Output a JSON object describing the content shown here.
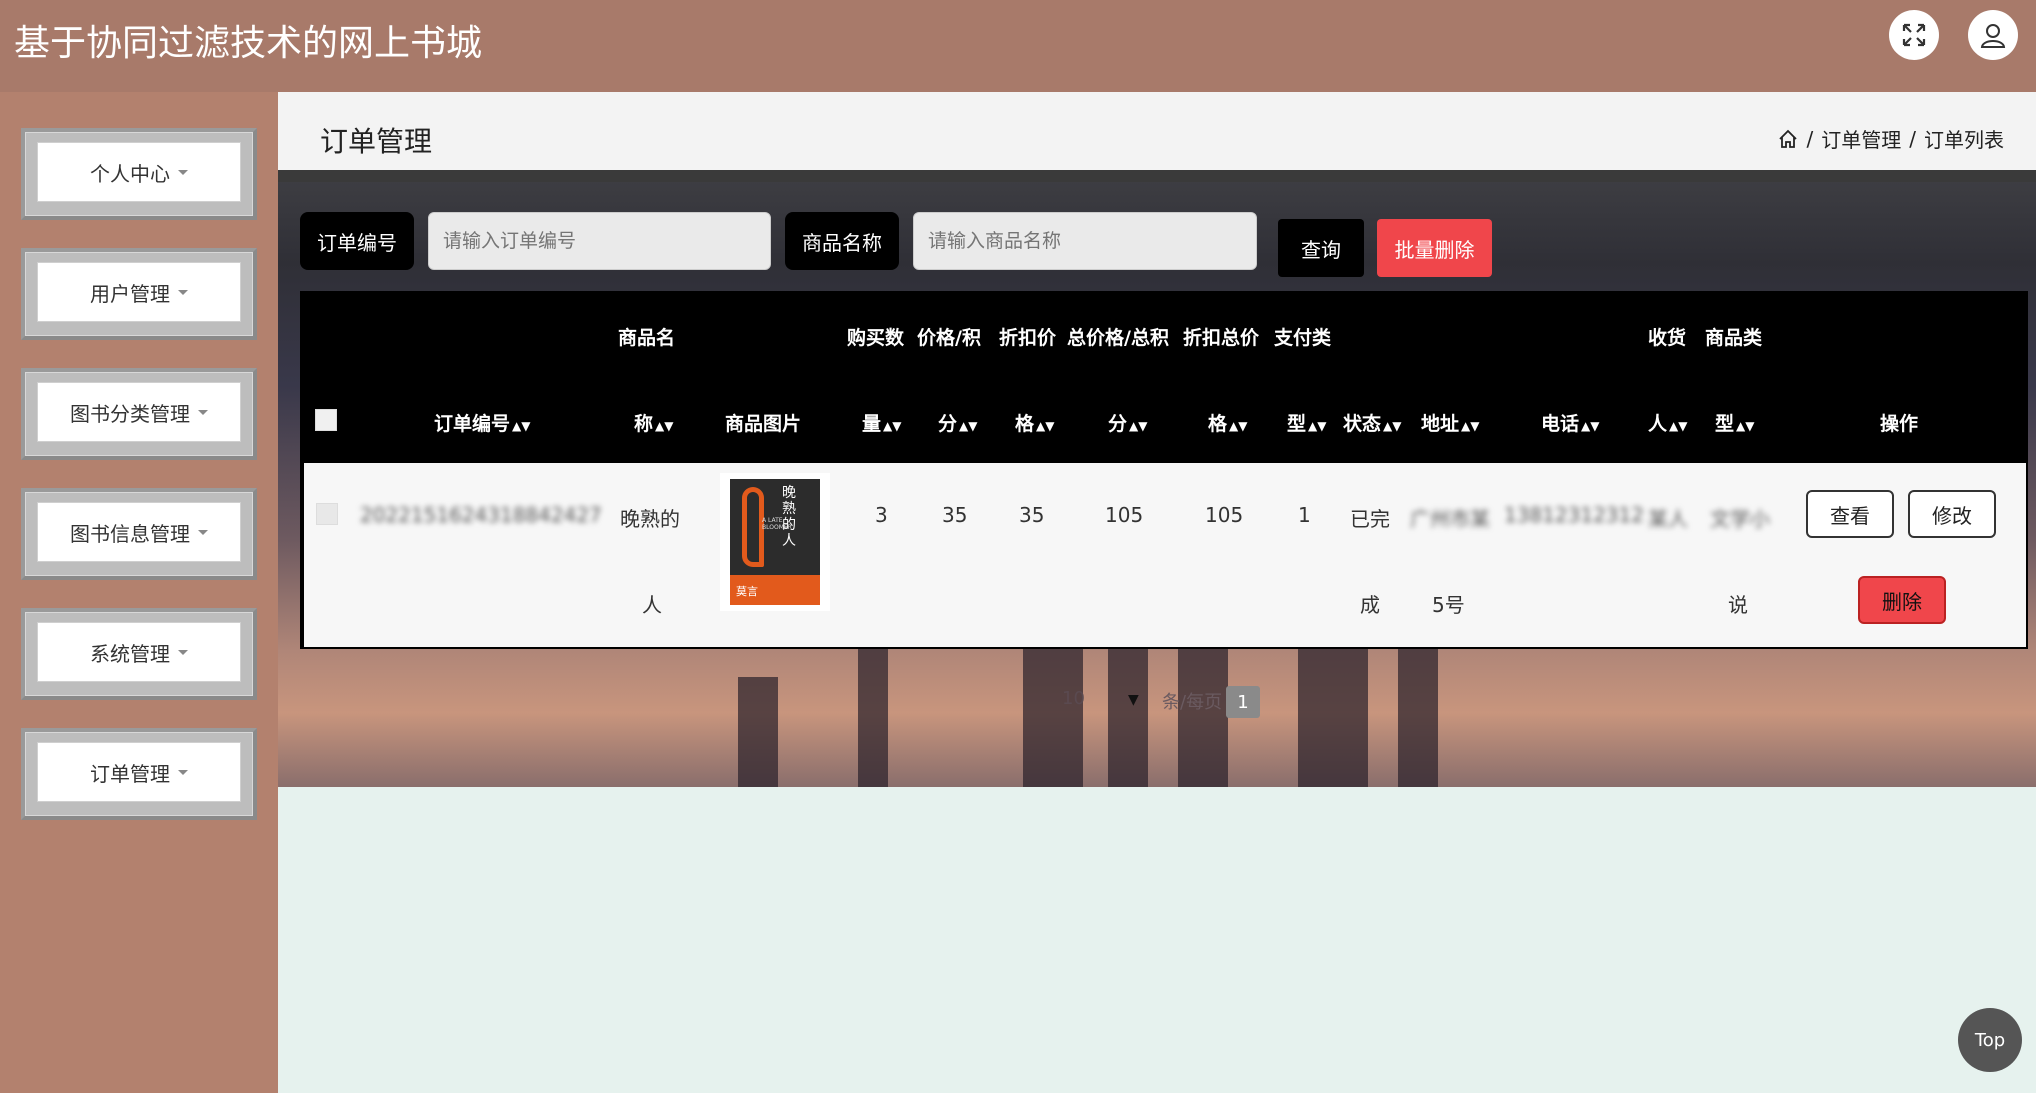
{
  "app": {
    "title": "基于协同过滤技术的网上书城"
  },
  "header": {
    "fullscreen_icon": "fullscreen-icon",
    "user_icon": "user-icon"
  },
  "sidebar": {
    "items": [
      {
        "label": "个人中心"
      },
      {
        "label": "用户管理"
      },
      {
        "label": "图书分类管理"
      },
      {
        "label": "图书信息管理"
      },
      {
        "label": "系统管理"
      },
      {
        "label": "订单管理"
      }
    ]
  },
  "page": {
    "title": "订单管理"
  },
  "breadcrumb": {
    "home_icon": "home-icon",
    "sep": "/",
    "level1": "订单管理",
    "level2": "订单列表"
  },
  "search": {
    "order_no_label": "订单编号",
    "order_no_placeholder": "请输入订单编号",
    "product_name_label": "商品名称",
    "product_name_placeholder": "请输入商品名称",
    "query_button": "查询",
    "batch_delete_button": "批量删除"
  },
  "table": {
    "headers": {
      "order_no": "订单编号",
      "product_name_a": "商品名",
      "product_name_b": "称",
      "product_image": "商品图片",
      "qty_a": "购买数",
      "qty_b": "量",
      "price_a": "价格/积",
      "price_b": "分",
      "discount_a": "折扣价",
      "discount_b": "格",
      "total_a": "总价格/总积",
      "total_b": "分",
      "discount_total_a": "折扣总价",
      "discount_total_b": "格",
      "pay_type_a": "支付类",
      "pay_type_b": "型",
      "status": "状态",
      "address": "地址",
      "phone": "电话",
      "receiver_a": "收货",
      "receiver_b": "人",
      "category_a": "商品类",
      "category_b": "型",
      "actions": "操作"
    },
    "rows": [
      {
        "order_no": "2022151624318842427",
        "product_name_a": "晚熟的",
        "product_name_b": "人",
        "qty": "3",
        "price": "35",
        "discount": "35",
        "total": "105",
        "discount_total": "105",
        "pay_type": "1",
        "status_a": "已完",
        "status_b": "成",
        "address_a": "广州市某",
        "address_b": "5号",
        "phone": "13812312312",
        "receiver": "某人",
        "category_a": "文学小",
        "category_b": "说",
        "view_button": "查看",
        "edit_button": "修改",
        "delete_button": "删除"
      }
    ]
  },
  "book_cover": {
    "title_cn": "晚熟的人",
    "title_en": "A LATE BLOOMER",
    "author": "莫言",
    "bg": "#2c2c2c",
    "accent": "#e25a1c"
  },
  "pagination": {
    "page_size": "10",
    "per_page_label": "条/每页",
    "current_page": "1"
  },
  "back_to_top": {
    "label": "Top"
  },
  "colors": {
    "header": "#a87a6a",
    "sidebar": "#b3816e",
    "danger": "#f0464b",
    "content_bg": "#e6f2ee"
  }
}
